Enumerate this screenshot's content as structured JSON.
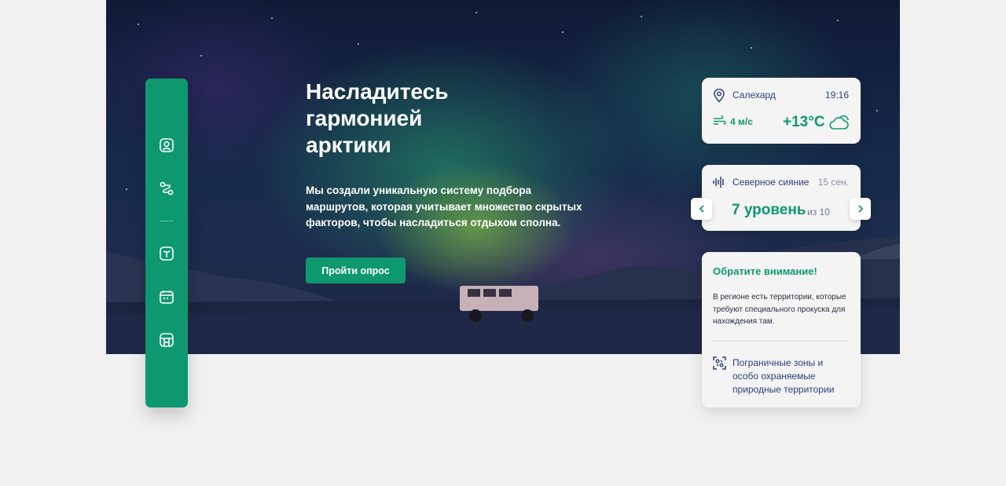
{
  "hero": {
    "title": "Насладитесь гармонией арктики",
    "description": "Мы создали уникальную систему подбора маршрутов, которая учитывает множество скрытых факторов, чтобы насладиться отдыхом сполна.",
    "cta_label": "Пройти опрос"
  },
  "sidebar": {
    "items": [
      {
        "icon": "profile-icon"
      },
      {
        "icon": "route-icon"
      },
      {
        "icon": "gift-icon"
      },
      {
        "icon": "calendar-icon"
      },
      {
        "icon": "store-icon"
      }
    ]
  },
  "weather": {
    "city": "Салехард",
    "time": "19:16",
    "wind": "4 м/с",
    "temperature": "+13°C",
    "icon": "cloud-sun-icon"
  },
  "aurora": {
    "label": "Северное сияние",
    "date": "15 сен.",
    "level": "7 уровень",
    "of_total": "из 10"
  },
  "notice": {
    "title": "Обратите внимание!",
    "text": "В регионе есть территории, которые требуют специального прокуска для нахождения там.",
    "link": "Пограничные зоны и особо охраняемые природные территории"
  },
  "colors": {
    "accent": "#0e9870",
    "text_blue": "#2d3f77",
    "background": "#f1f1f1"
  }
}
